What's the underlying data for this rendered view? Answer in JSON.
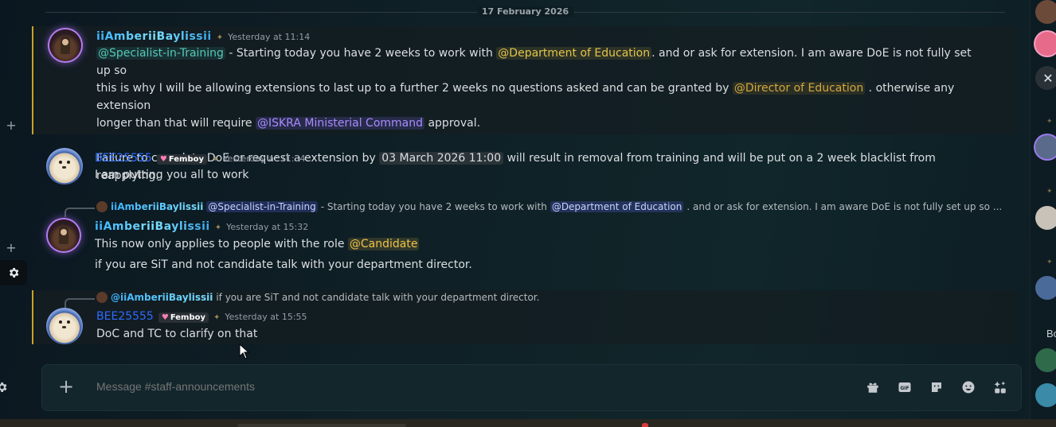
{
  "divider": {
    "date": "17 February 2026"
  },
  "messages": [
    {
      "author": "iiAmberiiBaylissii",
      "timestamp": "Yesterday at 11:14",
      "line1_mention": "@Specialist-in-Training",
      "line1_text_a": " - Starting today you have 2 weeks to work with ",
      "line1_mention2": "@Department of Education",
      "line1_text_b": ". and or ask for extension. I am aware DoE is not fully set up so",
      "line2_text": "this is why I will be allowing extensions to last up to a further 2 weeks no questions asked and can be granted by ",
      "line2_mention": "@Director of Education",
      "line2_text_b": " . otherwise any extension",
      "line3_text": "longer than that will require ",
      "line3_mention": "@ISKRA Ministerial Command",
      "line3_text_b": " approval.",
      "line4_text_a": "Failure to complete DoE or request a extension by ",
      "line4_date": "03 March 2026 11:00",
      "line4_text_b": " will result in removal from training and will be put on a 2 week blacklist from reapplying."
    },
    {
      "author": "BEE25555",
      "tag": "Femboy",
      "timestamp": "Yesterday at 11:34",
      "text": "I am putting you all to work"
    },
    {
      "reply_author": "iiAmberiiBaylissii",
      "reply_mention": "@Specialist-in-Training",
      "reply_text_a": " - Starting today you have 2 weeks to work with ",
      "reply_mention2": "@Department of Education",
      "reply_text_b": ". and or ask for extension. I am aware DoE is not fully set up so ...",
      "author": "iiAmberiiBaylissii",
      "timestamp": "Yesterday at 15:32",
      "line1_text": "This now only applies to people with the role ",
      "line1_mention": "@Candidate",
      "line2_text": "if you are SiT and not candidate talk with your department director."
    },
    {
      "reply_author": "@iiAmberiiBaylissii",
      "reply_text": "if you are SiT and not candidate talk with your department director.",
      "author": "BEE25555",
      "tag": "Femboy",
      "timestamp": "Yesterday at 15:55",
      "text": "DoC and TC to clarify on that"
    }
  ],
  "composer": {
    "placeholder": "Message #staff-announcements"
  },
  "right_strip": {
    "label": "Bo"
  },
  "icons": {
    "composer_tools": [
      "gift-icon",
      "gif-icon",
      "sticker-icon",
      "emoji-icon",
      "apps-icon"
    ]
  },
  "colors": {
    "highlight_border": "#c9a227",
    "mention_candidate": "#f0c247",
    "username_bee": "#2f6bff"
  }
}
